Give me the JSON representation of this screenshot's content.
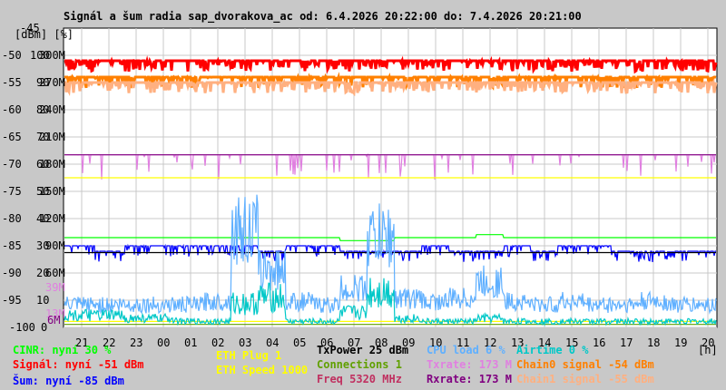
{
  "chart_data": {
    "type": "line",
    "title": "Signál a šum radia sap_dvorakova_ac od: 6.4.2026 20:22:00 do: 7.4.2026 20:21:00",
    "axis_units": "[dBm] [%]",
    "y_top_label": "-45",
    "y_ticks_dbm": [
      "-50",
      "-55",
      "-60",
      "-65",
      "-70",
      "-75",
      "-80",
      "-85",
      "-90",
      "-95",
      "-100"
    ],
    "y_ticks_pct": [
      "100",
      "90",
      "80",
      "70",
      "60",
      "50",
      "40",
      "30",
      "20",
      "10",
      "0"
    ],
    "y_ticks_rate": [
      "300M",
      "270M",
      "240M",
      "210M",
      "180M",
      "150M",
      "120M",
      "90M",
      "60M"
    ],
    "extra_rate_labels": [
      {
        "text": "39M",
        "color": "#e080e0",
        "value": 39
      },
      {
        "text": "13M",
        "color": "#e080e0",
        "value": 13
      },
      {
        "text": "6M",
        "color": "#800080",
        "value": 6
      }
    ],
    "ylim_dbm": [
      -100,
      -45
    ],
    "ylim_pct": [
      0,
      100
    ],
    "ylim_rate": [
      0,
      300
    ],
    "x_ticks": [
      "21",
      "22",
      "23",
      "00",
      "01",
      "02",
      "03",
      "04",
      "05",
      "06",
      "07",
      "08",
      "09",
      "10",
      "11",
      "12",
      "13",
      "14",
      "15",
      "16",
      "17",
      "18",
      "19",
      "20"
    ],
    "x_unit": "[h]",
    "grid": true,
    "series": [
      {
        "name": "Signál",
        "scale": "dbm",
        "color": "#ff0000",
        "values": [
          -51,
          -51,
          -51,
          -51,
          -51,
          -51,
          -51,
          -51,
          -51,
          -51,
          -51,
          -51,
          -51,
          -51,
          -51,
          -51,
          -51,
          -51,
          -51,
          -51,
          -51,
          -51,
          -51,
          -51
        ]
      },
      {
        "name": "Chain0 signal",
        "scale": "dbm",
        "color": "#ff8000",
        "values": [
          -54,
          -54,
          -54,
          -54,
          -54,
          -54,
          -54,
          -54,
          -54,
          -54,
          -54,
          -54,
          -54,
          -54,
          -54,
          -54,
          -54,
          -54,
          -54,
          -54,
          -54,
          -54,
          -54,
          -54
        ]
      },
      {
        "name": "Chain1 signal",
        "scale": "dbm",
        "color": "#ffb080",
        "values": [
          -55,
          -55,
          -55,
          -55,
          -55,
          -55,
          -55,
          -55,
          -55,
          -55,
          -55,
          -55,
          -55,
          -55,
          -55,
          -55,
          -55,
          -55,
          -55,
          -55,
          -55,
          -55,
          -55,
          -55
        ]
      },
      {
        "name": "Šum",
        "scale": "dbm",
        "color": "#0000ff",
        "values": [
          -85,
          -86,
          -85,
          -85,
          -85,
          -85,
          -85,
          -86,
          -85,
          -85,
          -86,
          -86,
          -86,
          -85,
          -86,
          -86,
          -85,
          -86,
          -85,
          -85,
          -86,
          -86,
          -86,
          -86
        ]
      },
      {
        "name": "CINR",
        "scale": "pct",
        "color": "#00ff00",
        "values": [
          30,
          30,
          30,
          30,
          30,
          30,
          30,
          30,
          30,
          30,
          29,
          29,
          30,
          30,
          30,
          31,
          30,
          30,
          30,
          30,
          30,
          30,
          30,
          30
        ]
      },
      {
        "name": "Txrate",
        "scale": "rate",
        "color": "#e080e0",
        "values": [
          173,
          173,
          173,
          173,
          173,
          173,
          173,
          173,
          173,
          173,
          173,
          173,
          173,
          173,
          173,
          173,
          173,
          173,
          173,
          173,
          173,
          173,
          173,
          173
        ]
      },
      {
        "name": "Rxrate",
        "scale": "rate",
        "color": "#800080",
        "values": [
          173,
          173,
          173,
          173,
          173,
          173,
          173,
          173,
          173,
          173,
          173,
          173,
          173,
          173,
          173,
          173,
          173,
          173,
          173,
          173,
          173,
          173,
          173,
          173
        ]
      },
      {
        "name": "ETH Speed",
        "scale": "rate",
        "color": "#ffff00",
        "values": [
          150,
          150,
          150,
          150,
          150,
          150,
          150,
          150,
          150,
          150,
          150,
          150,
          150,
          150,
          150,
          150,
          150,
          150,
          150,
          150,
          150,
          150,
          150,
          150
        ]
      },
      {
        "name": "ETH Plug",
        "scale": "pct",
        "color": "#ffff00",
        "values": [
          2,
          2,
          2,
          2,
          2,
          2,
          2,
          2,
          2,
          2,
          2,
          2,
          2,
          2,
          2,
          2,
          2,
          2,
          2,
          2,
          2,
          2,
          2,
          2
        ]
      },
      {
        "name": "TxPower",
        "scale": "pct",
        "color": "#000000",
        "values": [
          25,
          25,
          25,
          25,
          25,
          25,
          25,
          25,
          25,
          25,
          25,
          25,
          25,
          25,
          25,
          25,
          25,
          25,
          25,
          25,
          25,
          25,
          25,
          25
        ]
      },
      {
        "name": "Connections",
        "scale": "pct",
        "color": "#60a000",
        "values": [
          1,
          1,
          1,
          1,
          1,
          1,
          1,
          1,
          1,
          1,
          1,
          1,
          1,
          1,
          1,
          1,
          1,
          1,
          1,
          1,
          1,
          1,
          1,
          1
        ]
      },
      {
        "name": "CPU load",
        "scale": "pct",
        "color": "#60b0ff",
        "values": [
          7,
          7,
          7,
          7,
          7,
          8,
          30,
          18,
          8,
          7,
          12,
          28,
          9,
          8,
          9,
          14,
          8,
          7,
          8,
          7,
          7,
          8,
          7,
          7
        ]
      },
      {
        "name": "Airtime",
        "scale": "pct",
        "color": "#00c8c8",
        "values": [
          4,
          4,
          3,
          3,
          2,
          2,
          8,
          10,
          2,
          2,
          5,
          12,
          3,
          2,
          2,
          3,
          2,
          2,
          2,
          2,
          2,
          2,
          2,
          2
        ]
      }
    ]
  },
  "legend": {
    "cinr": "CINR: nyní 30 %",
    "signal": "Signál: nyní -51 dBm",
    "noise": "Šum: nyní -85 dBm",
    "eth_plug": "ETH Plug 1",
    "eth_speed": "ETH Speed 1000",
    "txpower": "TxPower 25 dBm",
    "connections": "Connections 1",
    "freq": "Freq 5320 MHz",
    "cpu": "CPU load 6 %",
    "txrate": "Txrate: 173 M",
    "rxrate": "Rxrate: 173 M",
    "airtime": "Airtime 0 %",
    "chain0": "Chain0 signal -54 dBm",
    "chain1": "Chain1 signal -55 dBm"
  }
}
